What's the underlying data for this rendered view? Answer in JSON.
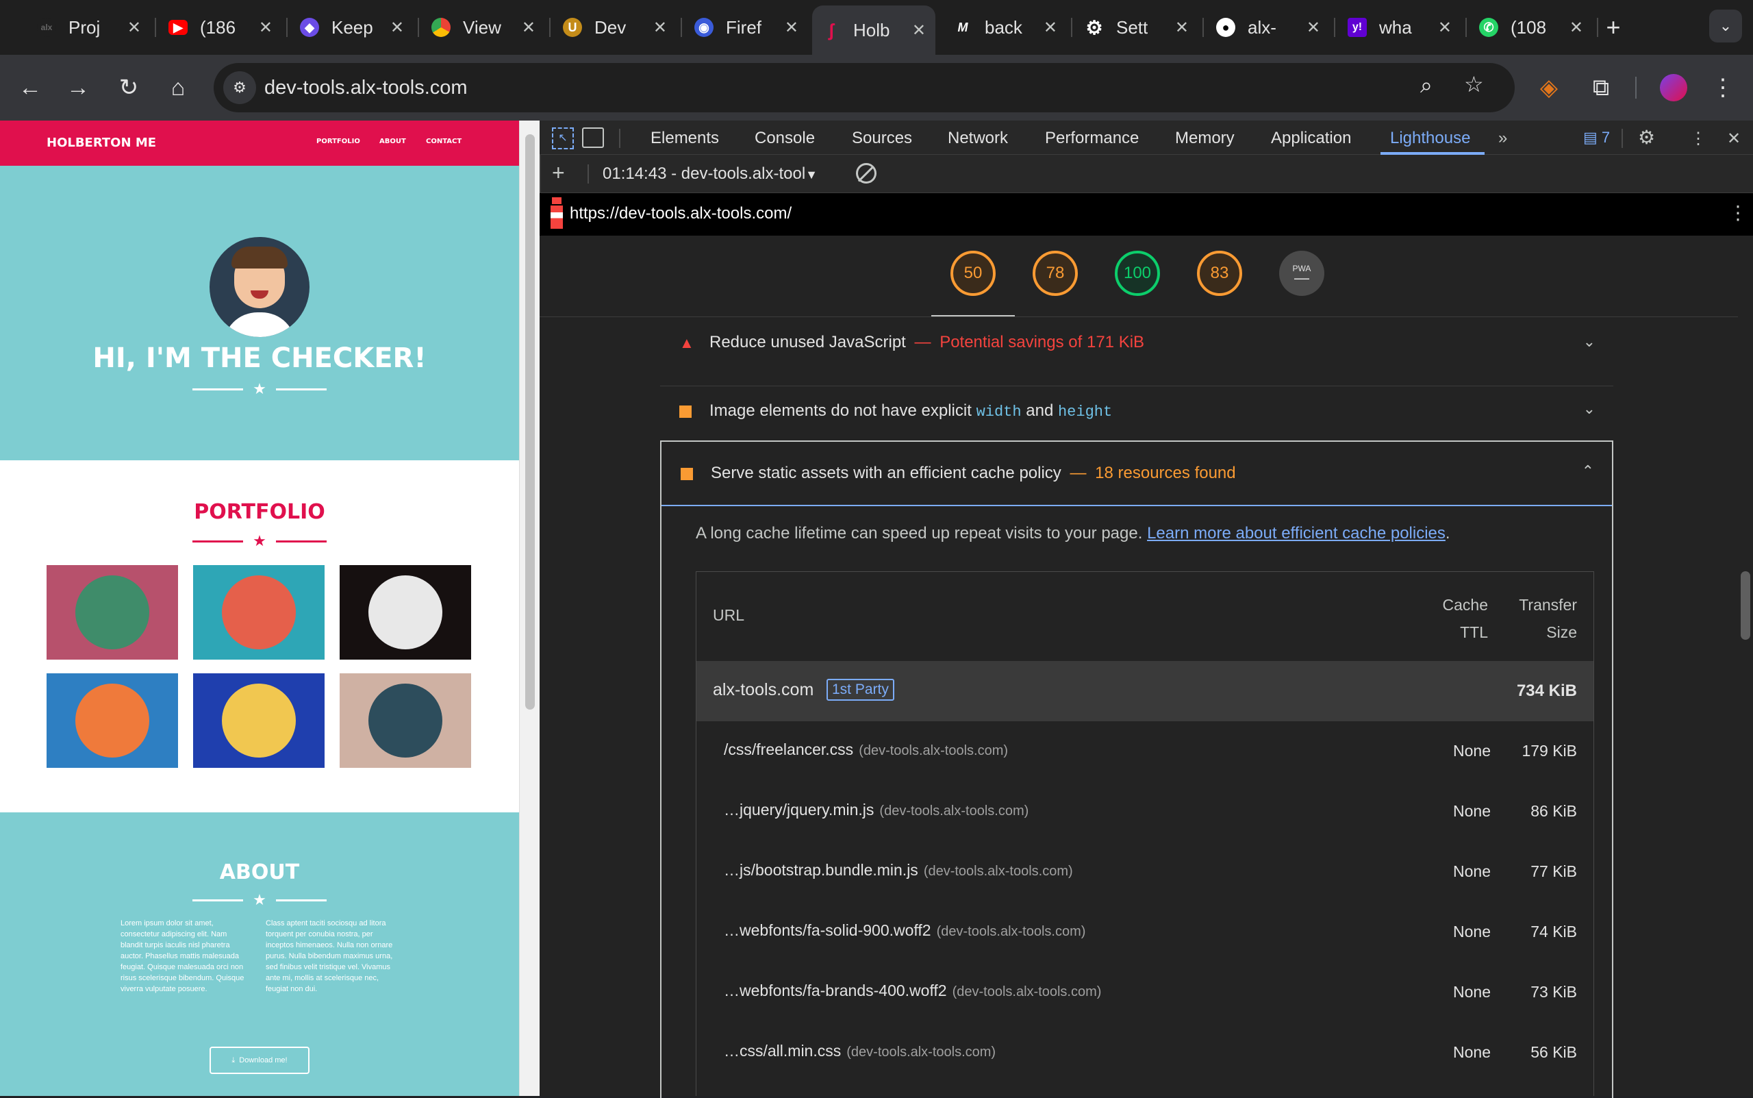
{
  "tabs": [
    {
      "title": "Proj",
      "color": "#1f1f1f",
      "glyph": "alx"
    },
    {
      "title": "(186",
      "color": "#ff0000",
      "glyph": "▶"
    },
    {
      "title": "Keep",
      "color": "#6b4ce6",
      "glyph": "◆"
    },
    {
      "title": "View",
      "color": "#4285f4",
      "glyph": "●"
    },
    {
      "title": "Dev",
      "color": "#c48c19",
      "glyph": "U"
    },
    {
      "title": "Firef",
      "color": "#3a5bd9",
      "glyph": "◉"
    },
    {
      "title": "Holb",
      "color": "#35363a",
      "glyph": "ʃ"
    },
    {
      "title": "back",
      "color": "#1f1f1f",
      "glyph": "M"
    },
    {
      "title": "Sett",
      "color": "#1f1f1f",
      "glyph": "⚙"
    },
    {
      "title": "alx-",
      "color": "#1f1f1f",
      "glyph": "●"
    },
    {
      "title": "wha",
      "color": "#6001d2",
      "glyph": "y!"
    },
    {
      "title": "(108",
      "color": "#25d366",
      "glyph": "✆"
    }
  ],
  "toolbar": {
    "url": "dev-tools.alx-tools.com"
  },
  "site": {
    "brand": "HOLBERTON ME",
    "nav": [
      "PORTFOLIO",
      "ABOUT",
      "CONTACT"
    ],
    "hero_title": "HI, I'M THE CHECKER!",
    "portfolio_title": "PORTFOLIO",
    "about_title": "ABOUT",
    "about_col1": "Lorem ipsum dolor sit amet, consectetur adipiscing elit. Nam blandit turpis iaculis nisl pharetra auctor. Phasellus mattis malesuada feugiat. Quisque malesuada orci non risus scelerisque bibendum. Quisque viverra vulputate posuere.",
    "about_col2": "Class aptent taciti sociosqu ad litora torquent per conubia nostra, per inceptos himenaeos. Nulla non ornare purus. Nulla bibendum maximus urna, sed finibus velit tristique vel. Vivamus ante mi, mollis at scelerisque nec, feugiat non dui.",
    "download_label": "Download me!",
    "colors": {
      "accent": "#e0104d",
      "teal": "#7ecdd1"
    }
  },
  "devtools": {
    "tabs": [
      "Elements",
      "Console",
      "Sources",
      "Network",
      "Performance",
      "Memory",
      "Application",
      "Lighthouse"
    ],
    "active_tab": "Lighthouse",
    "issues_count": "7",
    "report_select": "01:14:43 - dev-tools.alx-tool",
    "report_url": "https://dev-tools.alx-tools.com/",
    "scores": [
      {
        "value": "50",
        "color": "#fa9b33"
      },
      {
        "value": "78",
        "color": "#fa9b33"
      },
      {
        "value": "100",
        "color": "#0cce6b"
      },
      {
        "value": "83",
        "color": "#fa9b33"
      }
    ],
    "pwa_label": "PWA",
    "audits": {
      "a1_title": "Reduce unused JavaScript",
      "a1_dash": "—",
      "a1_detail": "Potential savings of 171 KiB",
      "a2_pre": "Image elements do not have explicit",
      "a2_code1": "width",
      "a2_and": "and",
      "a2_code2": "height",
      "a3_title": "Serve static assets with an efficient cache policy",
      "a3_dash": "—",
      "a3_detail": "18 resources found",
      "a3_desc": "A long cache lifetime can speed up repeat visits to your page.",
      "a3_link": "Learn more about efficient cache policies",
      "a3_period": "."
    },
    "table": {
      "headers": {
        "url": "URL",
        "ttl_1": "Cache",
        "ttl_2": "TTL",
        "size_1": "Transfer",
        "size_2": "Size"
      },
      "group": {
        "domain": "alx-tools.com",
        "badge": "1st Party",
        "size": "734 KiB"
      },
      "rows": [
        {
          "url": "/css/freelancer.css",
          "host": "(dev-tools.alx-tools.com)",
          "ttl": "None",
          "size": "179 KiB"
        },
        {
          "url": "…jquery/jquery.min.js",
          "host": "(dev-tools.alx-tools.com)",
          "ttl": "None",
          "size": "86 KiB"
        },
        {
          "url": "…js/bootstrap.bundle.min.js",
          "host": "(dev-tools.alx-tools.com)",
          "ttl": "None",
          "size": "77 KiB"
        },
        {
          "url": "…webfonts/fa-solid-900.woff2",
          "host": "(dev-tools.alx-tools.com)",
          "ttl": "None",
          "size": "74 KiB"
        },
        {
          "url": "…webfonts/fa-brands-400.woff2",
          "host": "(dev-tools.alx-tools.com)",
          "ttl": "None",
          "size": "73 KiB"
        },
        {
          "url": "…css/all.min.css",
          "host": "(dev-tools.alx-tools.com)",
          "ttl": "None",
          "size": "56 KiB"
        }
      ]
    }
  }
}
